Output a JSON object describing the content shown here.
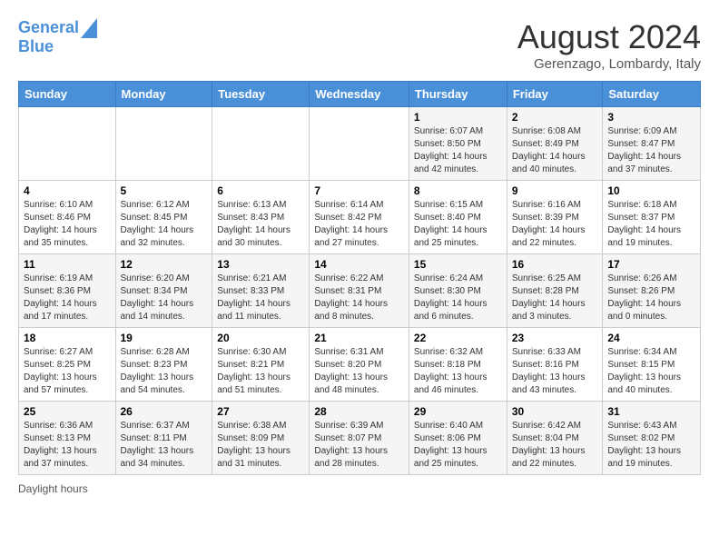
{
  "header": {
    "logo_line1": "General",
    "logo_line2": "Blue",
    "month_year": "August 2024",
    "location": "Gerenzago, Lombardy, Italy"
  },
  "days_of_week": [
    "Sunday",
    "Monday",
    "Tuesday",
    "Wednesday",
    "Thursday",
    "Friday",
    "Saturday"
  ],
  "weeks": [
    [
      {
        "day": "",
        "info": ""
      },
      {
        "day": "",
        "info": ""
      },
      {
        "day": "",
        "info": ""
      },
      {
        "day": "",
        "info": ""
      },
      {
        "day": "1",
        "info": "Sunrise: 6:07 AM\nSunset: 8:50 PM\nDaylight: 14 hours and 42 minutes."
      },
      {
        "day": "2",
        "info": "Sunrise: 6:08 AM\nSunset: 8:49 PM\nDaylight: 14 hours and 40 minutes."
      },
      {
        "day": "3",
        "info": "Sunrise: 6:09 AM\nSunset: 8:47 PM\nDaylight: 14 hours and 37 minutes."
      }
    ],
    [
      {
        "day": "4",
        "info": "Sunrise: 6:10 AM\nSunset: 8:46 PM\nDaylight: 14 hours and 35 minutes."
      },
      {
        "day": "5",
        "info": "Sunrise: 6:12 AM\nSunset: 8:45 PM\nDaylight: 14 hours and 32 minutes."
      },
      {
        "day": "6",
        "info": "Sunrise: 6:13 AM\nSunset: 8:43 PM\nDaylight: 14 hours and 30 minutes."
      },
      {
        "day": "7",
        "info": "Sunrise: 6:14 AM\nSunset: 8:42 PM\nDaylight: 14 hours and 27 minutes."
      },
      {
        "day": "8",
        "info": "Sunrise: 6:15 AM\nSunset: 8:40 PM\nDaylight: 14 hours and 25 minutes."
      },
      {
        "day": "9",
        "info": "Sunrise: 6:16 AM\nSunset: 8:39 PM\nDaylight: 14 hours and 22 minutes."
      },
      {
        "day": "10",
        "info": "Sunrise: 6:18 AM\nSunset: 8:37 PM\nDaylight: 14 hours and 19 minutes."
      }
    ],
    [
      {
        "day": "11",
        "info": "Sunrise: 6:19 AM\nSunset: 8:36 PM\nDaylight: 14 hours and 17 minutes."
      },
      {
        "day": "12",
        "info": "Sunrise: 6:20 AM\nSunset: 8:34 PM\nDaylight: 14 hours and 14 minutes."
      },
      {
        "day": "13",
        "info": "Sunrise: 6:21 AM\nSunset: 8:33 PM\nDaylight: 14 hours and 11 minutes."
      },
      {
        "day": "14",
        "info": "Sunrise: 6:22 AM\nSunset: 8:31 PM\nDaylight: 14 hours and 8 minutes."
      },
      {
        "day": "15",
        "info": "Sunrise: 6:24 AM\nSunset: 8:30 PM\nDaylight: 14 hours and 6 minutes."
      },
      {
        "day": "16",
        "info": "Sunrise: 6:25 AM\nSunset: 8:28 PM\nDaylight: 14 hours and 3 minutes."
      },
      {
        "day": "17",
        "info": "Sunrise: 6:26 AM\nSunset: 8:26 PM\nDaylight: 14 hours and 0 minutes."
      }
    ],
    [
      {
        "day": "18",
        "info": "Sunrise: 6:27 AM\nSunset: 8:25 PM\nDaylight: 13 hours and 57 minutes."
      },
      {
        "day": "19",
        "info": "Sunrise: 6:28 AM\nSunset: 8:23 PM\nDaylight: 13 hours and 54 minutes."
      },
      {
        "day": "20",
        "info": "Sunrise: 6:30 AM\nSunset: 8:21 PM\nDaylight: 13 hours and 51 minutes."
      },
      {
        "day": "21",
        "info": "Sunrise: 6:31 AM\nSunset: 8:20 PM\nDaylight: 13 hours and 48 minutes."
      },
      {
        "day": "22",
        "info": "Sunrise: 6:32 AM\nSunset: 8:18 PM\nDaylight: 13 hours and 46 minutes."
      },
      {
        "day": "23",
        "info": "Sunrise: 6:33 AM\nSunset: 8:16 PM\nDaylight: 13 hours and 43 minutes."
      },
      {
        "day": "24",
        "info": "Sunrise: 6:34 AM\nSunset: 8:15 PM\nDaylight: 13 hours and 40 minutes."
      }
    ],
    [
      {
        "day": "25",
        "info": "Sunrise: 6:36 AM\nSunset: 8:13 PM\nDaylight: 13 hours and 37 minutes."
      },
      {
        "day": "26",
        "info": "Sunrise: 6:37 AM\nSunset: 8:11 PM\nDaylight: 13 hours and 34 minutes."
      },
      {
        "day": "27",
        "info": "Sunrise: 6:38 AM\nSunset: 8:09 PM\nDaylight: 13 hours and 31 minutes."
      },
      {
        "day": "28",
        "info": "Sunrise: 6:39 AM\nSunset: 8:07 PM\nDaylight: 13 hours and 28 minutes."
      },
      {
        "day": "29",
        "info": "Sunrise: 6:40 AM\nSunset: 8:06 PM\nDaylight: 13 hours and 25 minutes."
      },
      {
        "day": "30",
        "info": "Sunrise: 6:42 AM\nSunset: 8:04 PM\nDaylight: 13 hours and 22 minutes."
      },
      {
        "day": "31",
        "info": "Sunrise: 6:43 AM\nSunset: 8:02 PM\nDaylight: 13 hours and 19 minutes."
      }
    ]
  ],
  "footer": {
    "note": "Daylight hours"
  }
}
